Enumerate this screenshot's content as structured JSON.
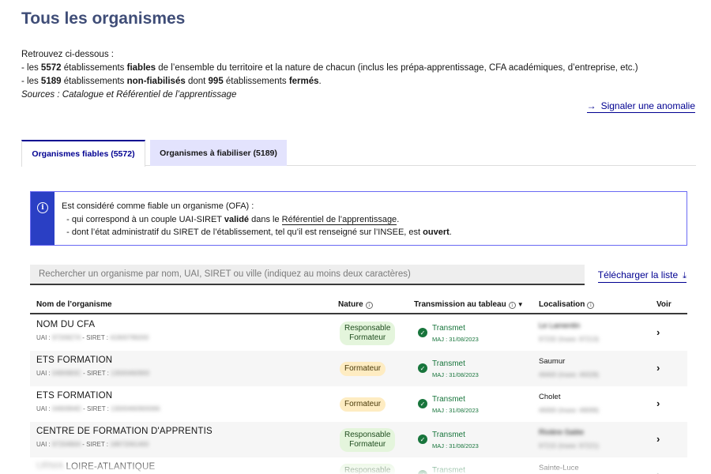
{
  "page": {
    "title": "Tous les organismes"
  },
  "intro": {
    "line1": "Retrouvez ci-dessous :",
    "line2_prefix": " - les ",
    "line2_count": "5572",
    "line2_mid": " établissements ",
    "line2_bold": "fiables",
    "line2_suffix": " de l’ensemble du territoire et la nature de chacun (inclus les prépa-apprentissage, CFA académiques, d’entreprise, etc.)",
    "line3_prefix": " - les ",
    "line3_count": "5189",
    "line3_mid": " établissements ",
    "line3_bold": "non-fiabilisés",
    "line3_mid2": " dont ",
    "line3_count2": "995",
    "line3_mid3": " établissements ",
    "line3_bold2": "fermés",
    "line3_end": ".",
    "sources": "Sources : Catalogue et Référentiel de l’apprentissage"
  },
  "report_link": {
    "arrow": "→",
    "label": "Signaler une anomalie"
  },
  "tabs": [
    {
      "label": "Organismes fiables (5572)",
      "active": true
    },
    {
      "label": "Organismes à fiabiliser (5189)",
      "active": false
    }
  ],
  "alert": {
    "icon": "info-icon",
    "line1": "Est considéré comme fiable un organisme (OFA) :",
    "line2_prefix": "- qui correspond à un couple UAI-SIRET ",
    "line2_bold": "validé",
    "line2_mid": " dans le ",
    "line2_link": "Référentiel de l’apprentissage",
    "line2_end": ".",
    "line3_prefix": "- dont l’état administratif du SIRET de l’établissement, tel qu’il est renseigné sur l’INSEE, est ",
    "line3_bold": "ouvert",
    "line3_end": "."
  },
  "search": {
    "placeholder": "Rechercher un organisme par nom, UAI, SIRET ou ville (indiquez au moins deux caractères)",
    "value": ""
  },
  "download": {
    "label": "Télécharger la liste",
    "icon": "download-icon"
  },
  "table": {
    "headers": {
      "name": "Nom de l’organisme",
      "nature": "Nature",
      "transmission": "Transmission au tableau",
      "location": "Localisation",
      "view": "Voir"
    },
    "rows": [
      {
        "name": "NOM DU CFA",
        "uai_label": "UAI : ",
        "uai": "9720927A",
        "siret_label": " - SIRET : ",
        "siret": "41900799200",
        "nature_line1": "Responsable",
        "nature_line2": "Formateur",
        "nature_color": "green",
        "status": "Transmet",
        "status_date": "MAJ : 31/08/2023",
        "city": "Le Lamentin",
        "insee": "97232 (Insee: 97213)"
      },
      {
        "name": "ETS FORMATION",
        "uai_label": "UAI : ",
        "uai": "0490983C",
        "siret_label": " - SIRET : ",
        "siret": "13000460900",
        "nature_line1": "Formateur",
        "nature_line2": "",
        "nature_color": "yellow",
        "status": "Transmet",
        "status_date": "MAJ : 31/08/2023",
        "city": "Saumur",
        "insee": "49400 (Insee: 49328)"
      },
      {
        "name": "ETS FORMATION",
        "uai_label": "UAI : ",
        "uai": "0490994D",
        "siret_label": " - SIRET : ",
        "siret": "13000460900066",
        "nature_line1": "Formateur",
        "nature_line2": "",
        "nature_color": "yellow",
        "status": "Transmet",
        "status_date": "MAJ : 31/08/2023",
        "city": "Cholet",
        "insee": "49300 (Insee: 49099)"
      },
      {
        "name": "CENTRE DE FORMATION D'APPRENTIS",
        "uai_label": "UAI : ",
        "uai": "9720490A",
        "siret_label": " - SIRET : ",
        "siret": "18972061400",
        "nature_line1": "Responsable",
        "nature_line2": "Formateur",
        "nature_color": "green",
        "status": "Transmet",
        "status_date": "MAJ : 31/08/2023",
        "city": "Rivière-Salée",
        "insee": "97215 (Insee: 97221)"
      },
      {
        "name": "LOIRE-ATLANTIQUE",
        "name_prefix": "URMA",
        "uai_label": "",
        "uai": "",
        "siret_label": "",
        "siret": "",
        "nature_line1": "Responsable",
        "nature_line2": "",
        "nature_color": "green",
        "status": "Transmet",
        "status_date": "",
        "city": "Sainte-Luce",
        "insee": ""
      }
    ]
  },
  "colors": {
    "title": "#3f4d77",
    "primary": "#000091",
    "tab_inactive_bg": "#e3e3fd",
    "alert_bar": "#2a3fc4",
    "success": "#18753c",
    "badge_green": "#e4f5dc",
    "badge_yellow": "#feecc2"
  }
}
